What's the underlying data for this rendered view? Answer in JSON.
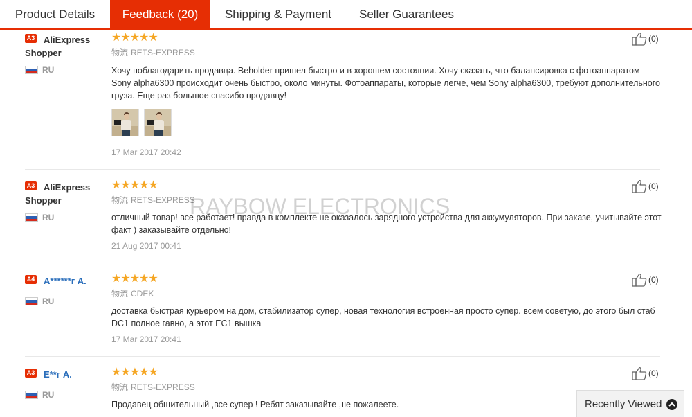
{
  "tabs": [
    {
      "label": "Product Details"
    },
    {
      "label": "Feedback (20)"
    },
    {
      "label": "Shipping & Payment"
    },
    {
      "label": "Seller Guarantees"
    }
  ],
  "active_tab_color": "#e62e04",
  "star_color": "#f5a623",
  "reviews": [
    {
      "level": "A3",
      "user_name_1": "AliExpress",
      "user_name_2": "Shopper",
      "country": "RU",
      "rating": 5,
      "stars": "★★★★★",
      "logistics_label": "物流",
      "logistics": "RETS-EXPRESS",
      "text": "Хочу поблагодарить продавца. Beholder пришел быстро и в хорошем состоянии. Хочу сказать, что балансировка с фотоаппаратом Sony alpha6300 происходит очень быстро, около минуты. Фотоаппараты, которые легче, чем Sony alpha6300, требуют дополнительного груза. Еще раз большое спасибо продавцу!",
      "date": "17 Mar 2017 20:42",
      "likes": "(0)"
    },
    {
      "level": "A3",
      "user_name_1": "AliExpress",
      "user_name_2": "Shopper",
      "country": "RU",
      "rating": 5,
      "stars": "★★★★★",
      "logistics_label": "物流",
      "logistics": "RETS-EXPRESS",
      "text": "отличный товар! все работает! правда в комплекте не оказалось зарядного устройства для аккумуляторов. При заказе, учитывайте этот факт ) заказывайте отдельно!",
      "date": "21 Aug 2017 00:41",
      "likes": "(0)"
    },
    {
      "level": "A4",
      "user_name_1": "A******г A.",
      "country": "RU",
      "rating": 5,
      "stars": "★★★★★",
      "logistics_label": "物流",
      "logistics": "CDEK",
      "text": "доставка быстрая курьером на дом, стабилизатор супер, новая технология встроенная просто супер. всем советую, до этого был стаб DC1 полное гавно, а этот EC1 вышка",
      "date": "17 Mar 2017 20:41",
      "likes": "(0)"
    },
    {
      "level": "A3",
      "user_name_1": "E**г A.",
      "country": "RU",
      "rating": 5,
      "stars": "★★★★★",
      "logistics_label": "物流",
      "logistics": "RETS-EXPRESS",
      "text": "Продавец общительный ,все супер ! Ребят заказывайте ,не пожалеете.",
      "likes": "(0)"
    }
  ],
  "watermark": "RAYBOW ELECTRONICS",
  "recently_viewed": {
    "label": "Recently Viewed",
    "icon": "chevron-up-circle-icon"
  }
}
